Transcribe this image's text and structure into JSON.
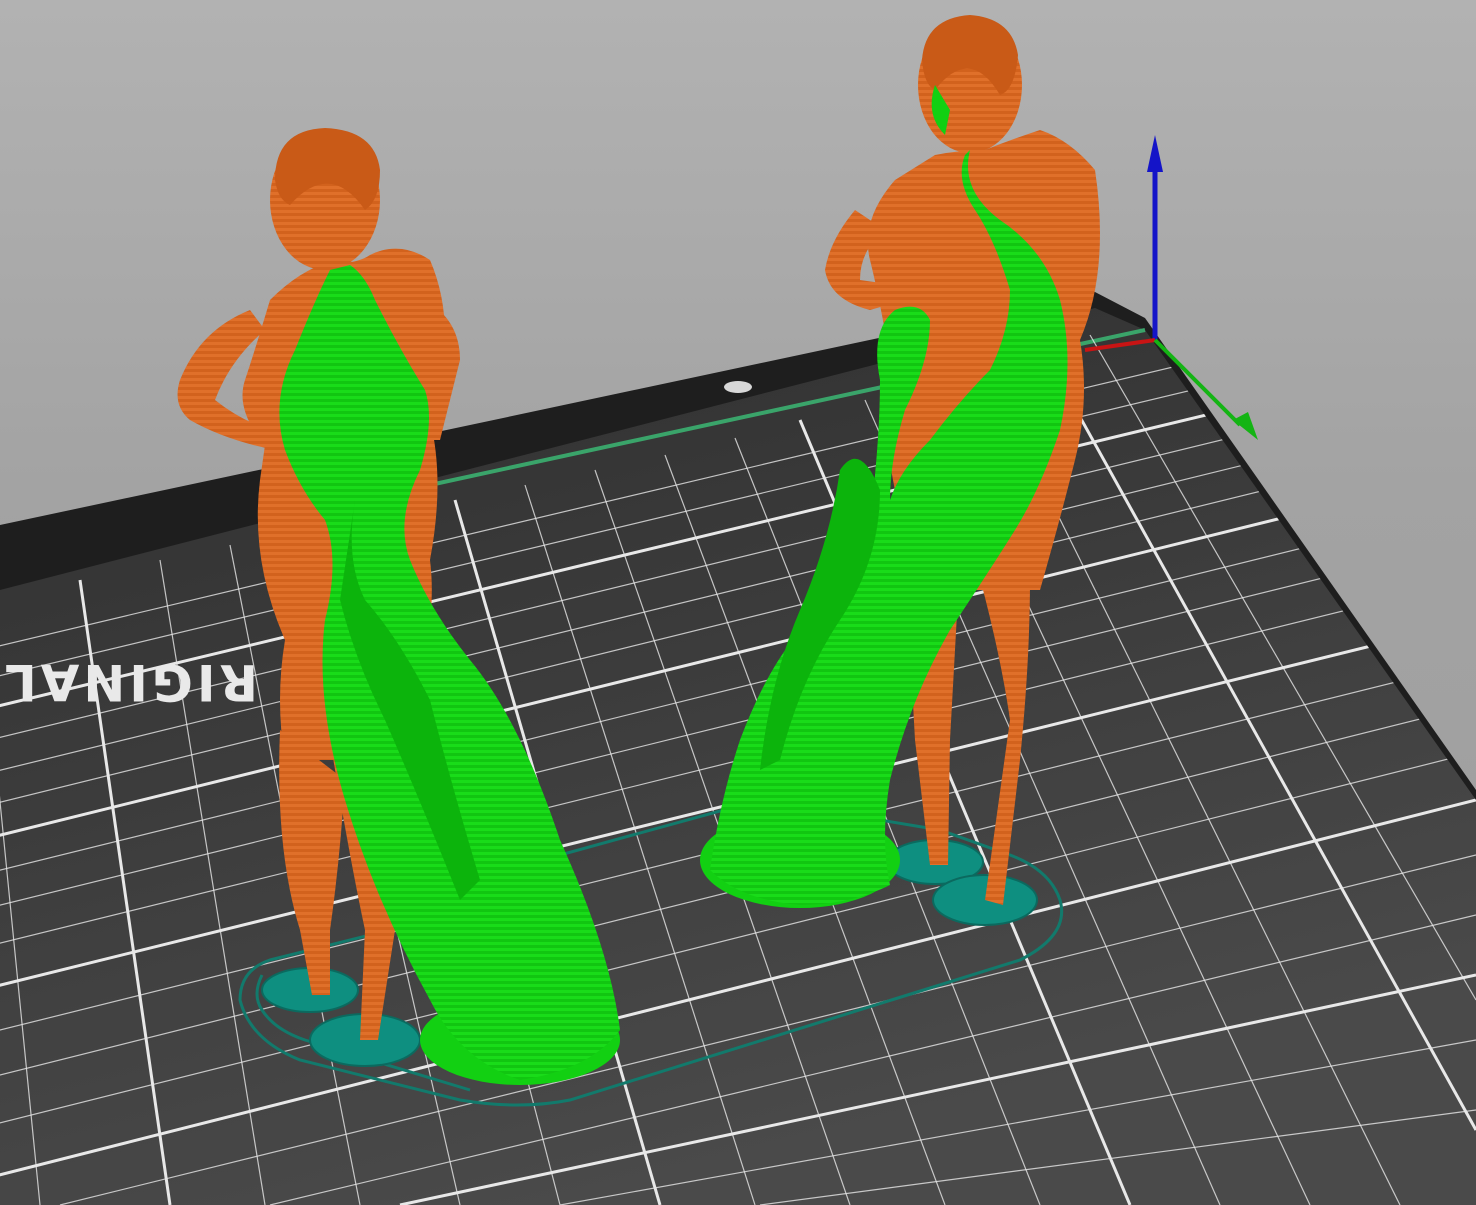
{
  "viewport": {
    "bed_label": "RIGINAL"
  },
  "objects": [
    {
      "name": "figure-left",
      "model_color": "#d9661f",
      "support_color": "#12d012"
    },
    {
      "name": "figure-right",
      "model_color": "#d9661f",
      "support_color": "#12d012"
    }
  ],
  "axes": [
    {
      "name": "z-axis",
      "color": "#1414c8"
    },
    {
      "name": "x-axis",
      "color": "#c81414"
    },
    {
      "name": "y-axis",
      "color": "#14b414"
    }
  ],
  "colors": {
    "background": "#a6a6a6",
    "bed_surface": "#3a3a3a",
    "bed_edge": "#1f1f1f",
    "grid_line": "#f2f2f2",
    "skirt": "#107a6a",
    "raft": "#0e8f80"
  }
}
